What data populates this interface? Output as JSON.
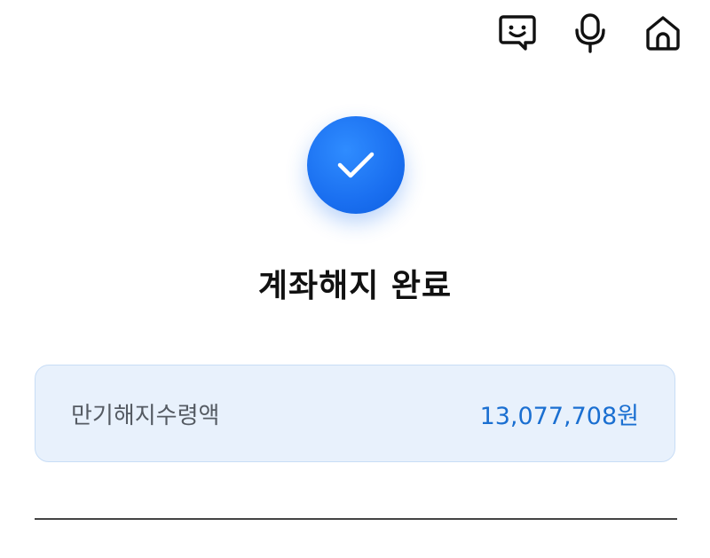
{
  "header": {
    "icons": [
      "chatbot-icon",
      "microphone-icon",
      "home-icon"
    ]
  },
  "result": {
    "title": "계좌해지 완료"
  },
  "summary": {
    "label": "만기해지수령액",
    "value": "13,077,708원"
  },
  "colors": {
    "accent": "#1a6ff0",
    "card_bg": "#e8f1fc",
    "value_text": "#1a6fd1"
  }
}
